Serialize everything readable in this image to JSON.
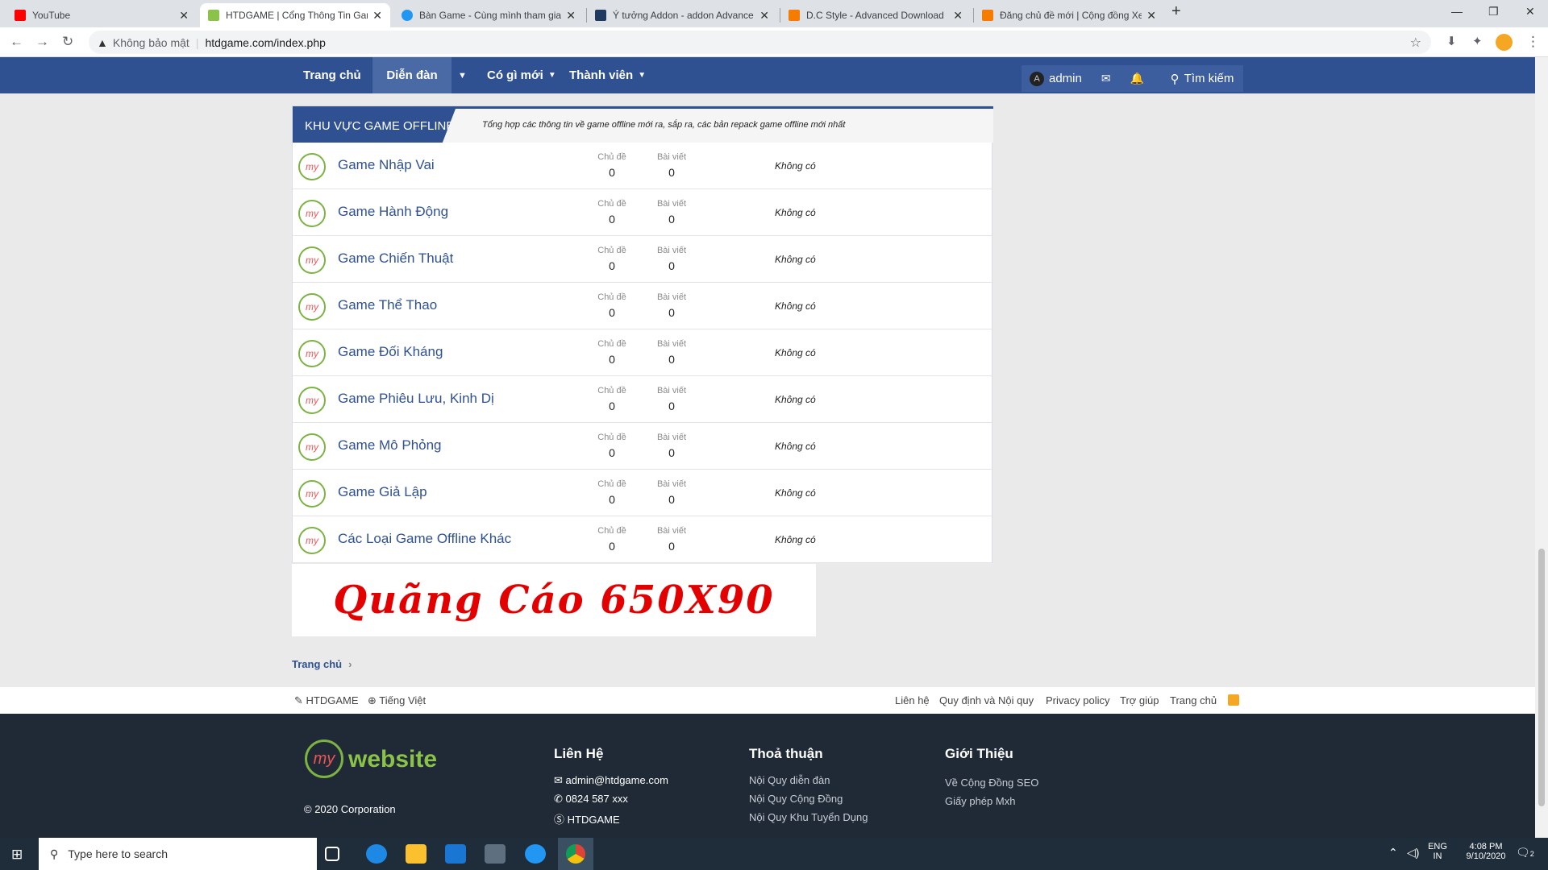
{
  "browser": {
    "tabs": [
      {
        "title": "YouTube",
        "color": "#ff0000"
      },
      {
        "title": "HTDGAME | Cổng Thông Tin Gam",
        "color": "#8bc34a"
      },
      {
        "title": "Bàn Game - Cùng mình tham gia",
        "color": "#2196f3"
      },
      {
        "title": "Ý tưởng Addon - addon Advance",
        "color": "#1e3a5f"
      },
      {
        "title": "D.C Style - Advanced Download",
        "color": "#f57c00"
      },
      {
        "title": "Đăng chủ đề mới | Cộng đồng Xe",
        "color": "#f57c00"
      }
    ],
    "new_tab": "+",
    "security_label": "Không bảo mật",
    "url": "htdgame.com/index.php"
  },
  "site_nav": {
    "home": "Trang chủ",
    "forum": "Diễn đàn",
    "whats_new": "Có gì mới",
    "members": "Thành viên",
    "user": "admin",
    "search": "Tìm kiếm"
  },
  "category": {
    "title": "KHU VỰC GAME OFFLINE",
    "description": "Tổng hợp các thông tin về game offline mới ra, sắp ra, các bản repack game offline mới nhất",
    "col_threads": "Chủ đề",
    "col_posts": "Bài viết",
    "forums": [
      {
        "name": "Game Nhập Vai",
        "threads": "0",
        "posts": "0",
        "last": "Không có"
      },
      {
        "name": "Game Hành Động",
        "threads": "0",
        "posts": "0",
        "last": "Không có"
      },
      {
        "name": "Game Chiến Thuật",
        "threads": "0",
        "posts": "0",
        "last": "Không có"
      },
      {
        "name": "Game Thể Thao",
        "threads": "0",
        "posts": "0",
        "last": "Không có"
      },
      {
        "name": "Game Đối Kháng",
        "threads": "0",
        "posts": "0",
        "last": "Không có"
      },
      {
        "name": "Game Phiêu Lưu, Kinh Dị",
        "threads": "0",
        "posts": "0",
        "last": "Không có"
      },
      {
        "name": "Game Mô Phỏng",
        "threads": "0",
        "posts": "0",
        "last": "Không có"
      },
      {
        "name": "Game Giả Lập",
        "threads": "0",
        "posts": "0",
        "last": "Không có"
      },
      {
        "name": "Các Loại Game Offline Khác",
        "threads": "0",
        "posts": "0",
        "last": "Không có"
      }
    ],
    "icon_text": "my"
  },
  "ad_text": "Quãng Cáo 650X90",
  "breadcrumb": "Trang chủ",
  "footer_bar": {
    "style": "HTDGAME",
    "language": "Tiếng Việt",
    "links": [
      "Liên hệ",
      "Quy định và Nội quy",
      "Privacy policy",
      "Trợ giúp",
      "Trang chủ"
    ]
  },
  "footer": {
    "logo_my": "my",
    "logo_text": "website",
    "copyright": "© 2020 Corporation",
    "contact_title": "Liên Hệ",
    "email": "admin@htdgame.com",
    "phone": "0824 587 xxx",
    "skype": "HTDGAME",
    "terms_title": "Thoả thuận",
    "terms": [
      "Nội Quy diễn đàn",
      "Nội Quy Cộng Đồng",
      "Nội Quy Khu Tuyển Dụng"
    ],
    "intro_title": "Giới Thiệu",
    "intro": [
      "Về Cộng Đồng SEO",
      "Giấy phép Mxh"
    ]
  },
  "taskbar": {
    "search_placeholder": "Type here to search",
    "lang": "ENG",
    "region": "IN",
    "time": "4:08 PM",
    "date": "9/10/2020",
    "notif_count": "2"
  }
}
